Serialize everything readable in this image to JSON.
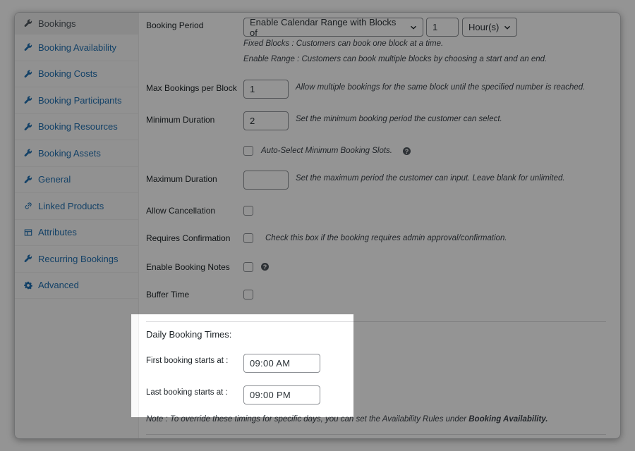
{
  "sidebar": {
    "items": [
      {
        "label": "Bookings",
        "icon": "wrench-icon",
        "active": true
      },
      {
        "label": "Booking Availability",
        "icon": "wrench-icon"
      },
      {
        "label": "Booking Costs",
        "icon": "wrench-icon"
      },
      {
        "label": "Booking Participants",
        "icon": "wrench-icon"
      },
      {
        "label": "Booking Resources",
        "icon": "wrench-icon"
      },
      {
        "label": "Booking Assets",
        "icon": "wrench-icon"
      },
      {
        "label": "General",
        "icon": "wrench-icon"
      },
      {
        "label": "Linked Products",
        "icon": "link-icon"
      },
      {
        "label": "Attributes",
        "icon": "table-icon"
      },
      {
        "label": "Recurring Bookings",
        "icon": "wrench-icon"
      },
      {
        "label": "Advanced",
        "icon": "gear-icon"
      }
    ]
  },
  "form": {
    "booking_period": {
      "label": "Booking Period",
      "mode_value": "Enable Calendar Range with Blocks of",
      "block_value": "1",
      "unit_value": "Hour(s)",
      "hint1": "Fixed Blocks : Customers can book one block at a time.",
      "hint2": "Enable Range : Customers can book multiple blocks by choosing a start and an end."
    },
    "max_bookings": {
      "label": "Max Bookings per Block",
      "value": "1",
      "hint": "Allow multiple bookings for the same block until the specified number is reached."
    },
    "min_duration": {
      "label": "Minimum Duration",
      "value": "2",
      "hint": "Set the minimum booking period the customer can select."
    },
    "auto_select": {
      "label": "Auto-Select Minimum Booking Slots."
    },
    "max_duration": {
      "label": "Maximum Duration",
      "value": "",
      "hint": "Set the maximum period the customer can input. Leave blank for unlimited."
    },
    "allow_cancellation": {
      "label": "Allow Cancellation"
    },
    "requires_confirmation": {
      "label": "Requires Confirmation",
      "hint": "Check this box if the booking requires admin approval/confirmation."
    },
    "booking_notes": {
      "label": "Enable Booking Notes"
    },
    "buffer_time": {
      "label": "Buffer Time"
    },
    "daily_times": {
      "heading": "Daily Booking Times:",
      "first_label": "First booking starts at :",
      "first_value": "09:00 AM",
      "last_label": "Last booking starts at :",
      "last_value": "09:00 PM"
    },
    "note": {
      "prefix": "Note : To override these timings for specific days, you can set the Availability Rules under ",
      "strong": "Booking Availability."
    }
  },
  "colors": {
    "link": "#2271b1",
    "overlay": "rgba(0,0,0,0.42)"
  }
}
